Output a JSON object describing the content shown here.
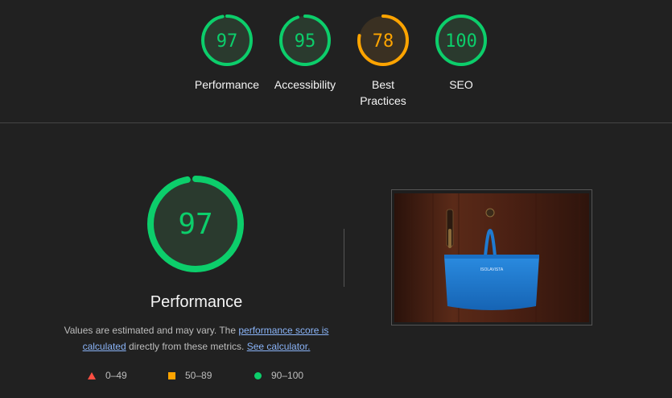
{
  "categories": [
    {
      "label_lines": [
        "Performance"
      ],
      "score": "97",
      "fraction": 0.97,
      "status": "pass"
    },
    {
      "label_lines": [
        "Accessibility"
      ],
      "score": "95",
      "fraction": 0.95,
      "status": "pass"
    },
    {
      "label_lines": [
        "Best",
        "Practices"
      ],
      "score": "78",
      "fraction": 0.78,
      "status": "average"
    },
    {
      "label_lines": [
        "SEO"
      ],
      "score": "100",
      "fraction": 1.0,
      "status": "pass"
    }
  ],
  "performance": {
    "score": "97",
    "fraction": 0.97,
    "title": "Performance",
    "desc_prefix": "Values are estimated and may vary. The ",
    "link_score": "performance score is calculated",
    "desc_middle": " directly from these metrics. ",
    "link_calc": "See calculator."
  },
  "legend": {
    "fail": "0–49",
    "average": "50–89",
    "pass": "90–100"
  },
  "colors": {
    "pass": "#0cce6b",
    "pass_bg": "#2a3a2e",
    "average": "#ffa400",
    "average_bg": "#3a3022",
    "fail": "#ff4e42"
  },
  "screenshot": {
    "icon": "final-screenshot",
    "bag_text": "ISOLAVISTA"
  }
}
